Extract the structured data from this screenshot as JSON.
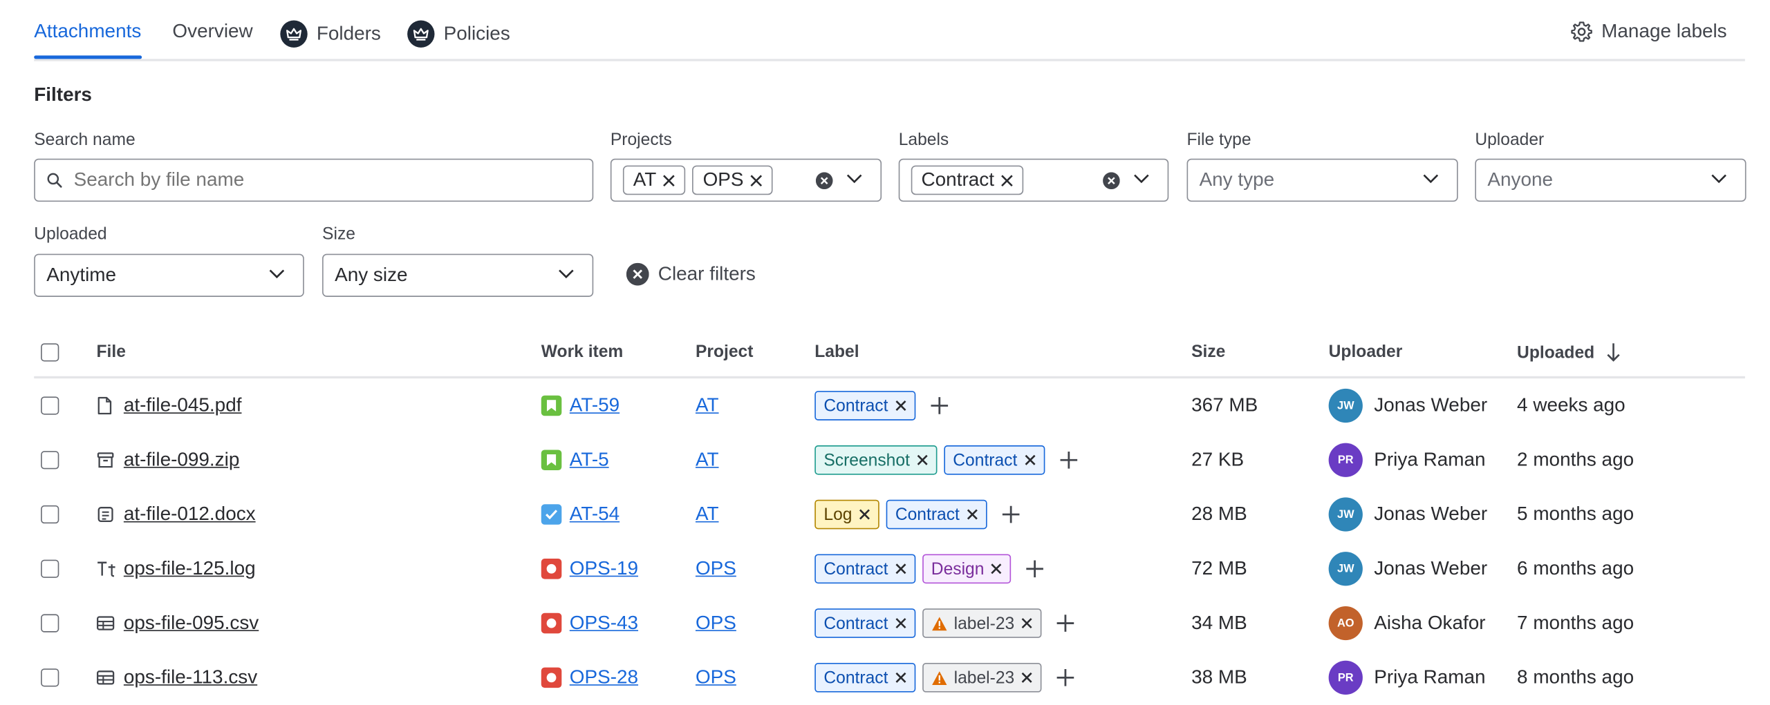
{
  "tabs": [
    {
      "label": "Attachments",
      "active": true
    },
    {
      "label": "Overview",
      "active": false
    },
    {
      "label": "Folders",
      "active": false,
      "icon": "crown-icon"
    },
    {
      "label": "Policies",
      "active": false,
      "icon": "crown-icon"
    }
  ],
  "manage_labels": "Manage labels",
  "filters": {
    "title": "Filters",
    "search": {
      "label": "Search name",
      "placeholder": "Search by file name",
      "value": ""
    },
    "projects": {
      "label": "Projects",
      "selected": [
        "AT",
        "OPS"
      ]
    },
    "labels": {
      "label": "Labels",
      "selected": [
        "Contract"
      ]
    },
    "file_type": {
      "label": "File type",
      "value": "Any type"
    },
    "uploader": {
      "label": "Uploader",
      "value": "Anyone"
    },
    "uploaded": {
      "label": "Uploaded",
      "value": "Anytime"
    },
    "size": {
      "label": "Size",
      "value": "Any size"
    },
    "clear": "Clear filters"
  },
  "table": {
    "columns": {
      "file": "File",
      "work_item": "Work item",
      "project": "Project",
      "label": "Label",
      "size": "Size",
      "uploader": "Uploader",
      "uploaded": "Uploaded"
    },
    "sort": {
      "column": "Uploaded",
      "direction": "descending"
    },
    "rows": [
      {
        "file": "at-file-045.pdf",
        "file_icon": "document-icon",
        "work_item": "AT-59",
        "work_type": "story",
        "project": "AT",
        "labels": [
          {
            "text": "Contract",
            "color": "blue"
          }
        ],
        "size": "367 MB",
        "uploader": "Jonas Weber",
        "initials": "JW",
        "avatar_color": "#2f86b8",
        "uploaded": "4 weeks ago"
      },
      {
        "file": "at-file-099.zip",
        "file_icon": "archive-icon",
        "work_item": "AT-5",
        "work_type": "story",
        "project": "AT",
        "labels": [
          {
            "text": "Screenshot",
            "color": "teal"
          },
          {
            "text": "Contract",
            "color": "blue"
          }
        ],
        "size": "27 KB",
        "uploader": "Priya Raman",
        "initials": "PR",
        "avatar_color": "#6a3cc4",
        "uploaded": "2 months ago"
      },
      {
        "file": "at-file-012.docx",
        "file_icon": "text-document-icon",
        "work_item": "AT-54",
        "work_type": "task",
        "project": "AT",
        "labels": [
          {
            "text": "Log",
            "color": "yellow"
          },
          {
            "text": "Contract",
            "color": "blue"
          }
        ],
        "size": "28 MB",
        "uploader": "Jonas Weber",
        "initials": "JW",
        "avatar_color": "#2f86b8",
        "uploaded": "5 months ago"
      },
      {
        "file": "ops-file-125.log",
        "file_icon": "text-format-icon",
        "work_item": "OPS-19",
        "work_type": "bug",
        "project": "OPS",
        "labels": [
          {
            "text": "Contract",
            "color": "blue"
          },
          {
            "text": "Design",
            "color": "purple"
          }
        ],
        "size": "72 MB",
        "uploader": "Jonas Weber",
        "initials": "JW",
        "avatar_color": "#2f86b8",
        "uploaded": "6 months ago"
      },
      {
        "file": "ops-file-095.csv",
        "file_icon": "table-icon",
        "work_item": "OPS-43",
        "work_type": "bug",
        "project": "OPS",
        "labels": [
          {
            "text": "Contract",
            "color": "blue"
          },
          {
            "text": "label-23",
            "color": "gray",
            "warning": true
          }
        ],
        "size": "34 MB",
        "uploader": "Aisha Okafor",
        "initials": "AO",
        "avatar_color": "#c2622b",
        "uploaded": "7 months ago"
      },
      {
        "file": "ops-file-113.csv",
        "file_icon": "table-icon",
        "work_item": "OPS-28",
        "work_type": "bug",
        "project": "OPS",
        "labels": [
          {
            "text": "Contract",
            "color": "blue"
          },
          {
            "text": "label-23",
            "color": "gray",
            "warning": true
          }
        ],
        "size": "38 MB",
        "uploader": "Priya Raman",
        "initials": "PR",
        "avatar_color": "#6a3cc4",
        "uploaded": "8 months ago"
      }
    ]
  }
}
